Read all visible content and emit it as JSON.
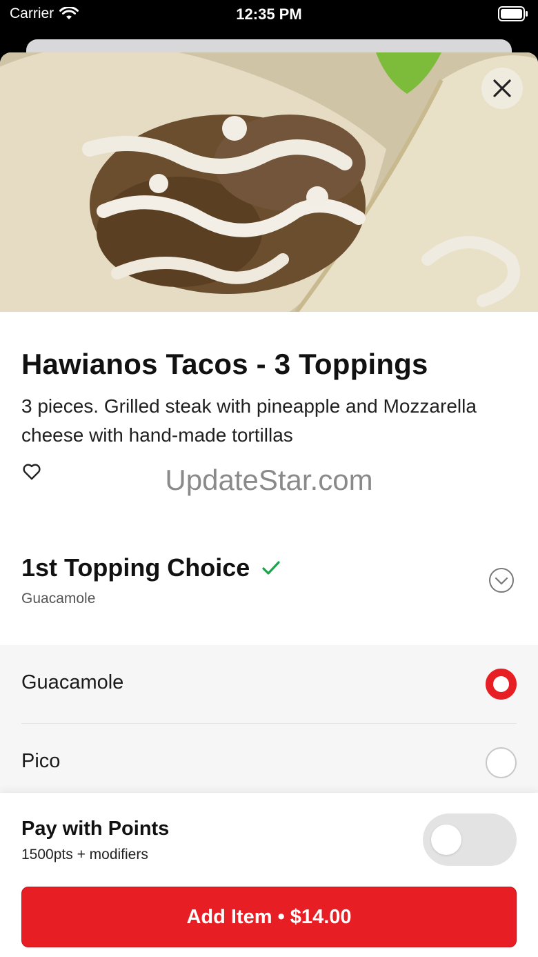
{
  "status_bar": {
    "carrier": "Carrier",
    "time": "12:35 PM"
  },
  "item": {
    "title": "Hawianos Tacos - 3 Toppings",
    "description": "3 pieces. Grilled steak with pineapple and Mozzarella cheese with hand-made tortillas"
  },
  "watermark": "UpdateStar.com",
  "modifier_group": {
    "title": "1st Topping Choice",
    "selected_summary": "Guacamole",
    "check_color": "#1aa34a",
    "options": [
      {
        "label": "Guacamole",
        "selected": true
      },
      {
        "label": "Pico",
        "selected": false
      }
    ]
  },
  "footer": {
    "points_title": "Pay with Points",
    "points_subtitle": "1500pts + modifiers",
    "points_toggle_on": false,
    "add_button_label": "Add Item • $14.00",
    "accent_color": "#e81e25"
  },
  "icons": {
    "close": "close-icon",
    "favorite": "heart-icon",
    "expand": "chevron-down-icon",
    "check": "checkmark-icon"
  }
}
